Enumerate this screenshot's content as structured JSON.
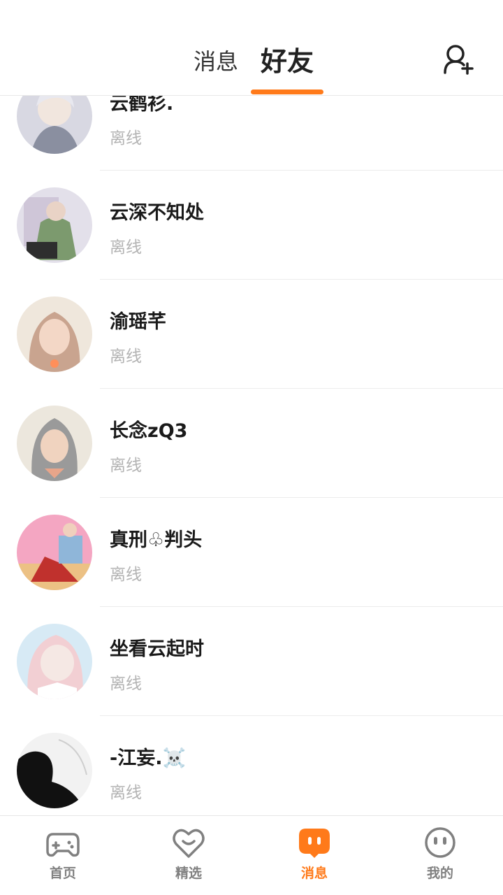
{
  "header": {
    "tabs": [
      {
        "label": "消息",
        "active": false
      },
      {
        "label": "好友",
        "active": true
      }
    ],
    "add_friend_icon": "add-user-icon"
  },
  "friends": [
    {
      "name": "云鹤衫.",
      "status": "离线",
      "avatar_colors": [
        "#d8d8e2",
        "#8a8fa0",
        "#f1e6de"
      ]
    },
    {
      "name": "云深不知处",
      "status": "离线",
      "avatar_colors": [
        "#e3e0ea",
        "#7c9a6e",
        "#2e2e2e"
      ]
    },
    {
      "name": "渝瑶芊",
      "status": "离线",
      "avatar_colors": [
        "#efe7dc",
        "#c9a48f",
        "#f3d7c6"
      ]
    },
    {
      "name": "长念zQ3",
      "status": "离线",
      "avatar_colors": [
        "#ece7dd",
        "#9a9a9a",
        "#f0d3bf"
      ]
    },
    {
      "name": "真刑♧判头",
      "status": "离线",
      "avatar_colors": [
        "#f4a6c2",
        "#c0312d",
        "#8fb6d9"
      ]
    },
    {
      "name": "坐看云起时",
      "status": "离线",
      "avatar_colors": [
        "#d7eaf5",
        "#f2cfd3",
        "#f5e8e4"
      ]
    },
    {
      "name": "-江妄.☠️",
      "status": "离线",
      "avatar_colors": [
        "#f2f2f2",
        "#111111",
        "#b0b0b0"
      ]
    }
  ],
  "bottom_nav": [
    {
      "label": "首页",
      "icon": "gamepad-icon",
      "active": false
    },
    {
      "label": "精选",
      "icon": "heart-chat-icon",
      "active": false
    },
    {
      "label": "消息",
      "icon": "message-bubble-icon",
      "active": true
    },
    {
      "label": "我的",
      "icon": "smiley-face-icon",
      "active": false
    }
  ],
  "colors": {
    "accent": "#ff7a1a",
    "inactive": "#808080",
    "status_text": "#b3b3b3"
  }
}
